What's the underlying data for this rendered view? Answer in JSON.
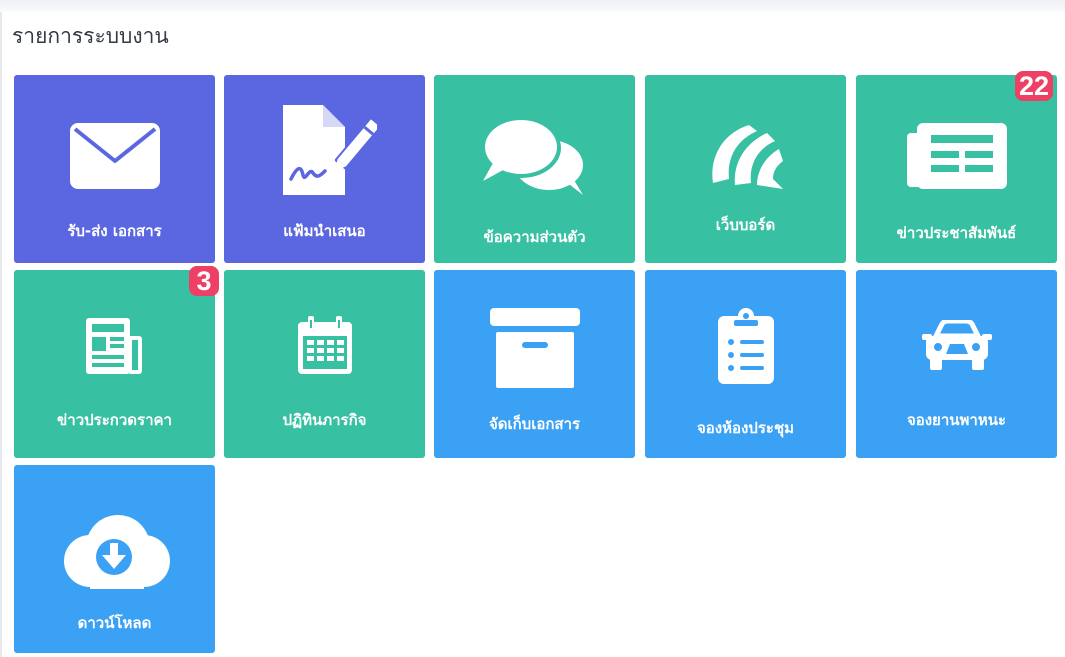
{
  "panel": {
    "title": "รายการระบบงาน"
  },
  "colors": {
    "indigo": "#5b67e0",
    "teal": "#37c0a1",
    "blue": "#3ba1f4",
    "badge": "#ee3f64"
  },
  "tiles": [
    {
      "label": "รับ-ส่ง เอกสาร",
      "icon": "envelope-icon"
    },
    {
      "label": "แฟ้มนำเสนอ",
      "icon": "document-signature-icon"
    },
    {
      "label": "ข้อความส่วนตัว",
      "icon": "chat-bubbles-icon"
    },
    {
      "label": "เว็บบอร์ด",
      "icon": "webboard-icon"
    },
    {
      "label": "ข่าวประชาสัมพันธ์",
      "icon": "newspaper-icon",
      "badge": "22"
    },
    {
      "label": "ข่าวประกวดราคา",
      "icon": "newspaper-small-icon",
      "badge": "3"
    },
    {
      "label": "ปฏิทินภารกิจ",
      "icon": "calendar-icon"
    },
    {
      "label": "จัดเก็บเอกสาร",
      "icon": "archive-box-icon"
    },
    {
      "label": "จองห้องประชุม",
      "icon": "clipboard-list-icon"
    },
    {
      "label": "จองยานพาหนะ",
      "icon": "car-icon"
    },
    {
      "label": "ดาวน์โหลด",
      "icon": "cloud-download-icon"
    }
  ]
}
